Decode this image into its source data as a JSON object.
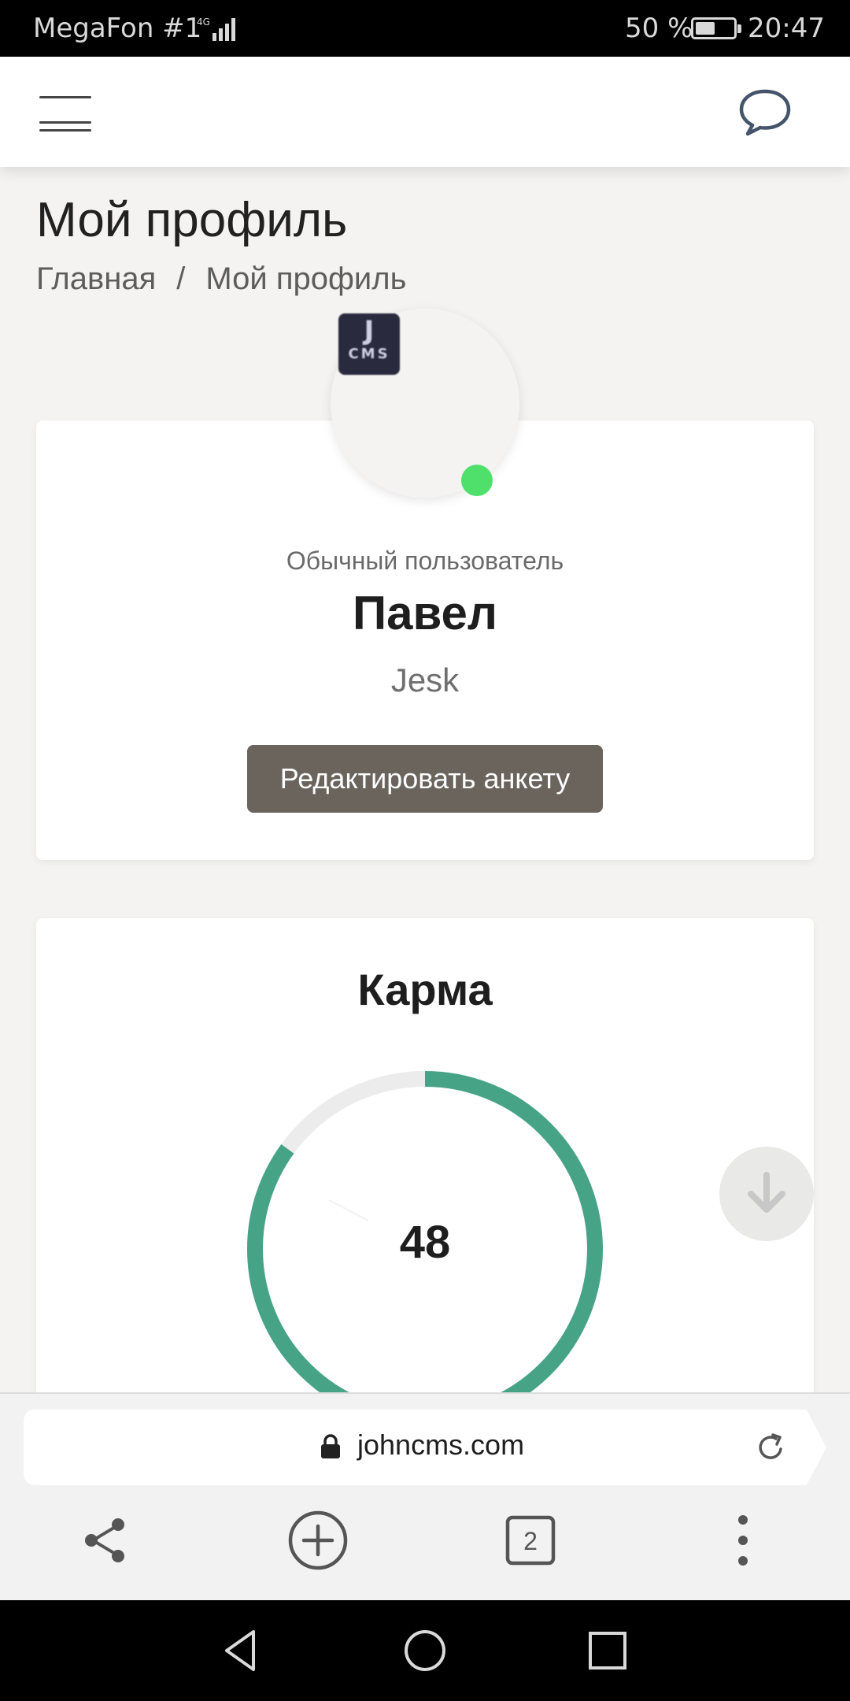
{
  "status_bar": {
    "carrier": "MegaFon #1",
    "network": "4G",
    "battery_percent": "50 %",
    "battery_level": 0.5,
    "time": "20:47"
  },
  "header": {
    "menu_icon": "hamburger-menu-icon",
    "chat_icon": "chat-bubble-icon"
  },
  "page": {
    "title": "Мой профиль",
    "breadcrumb": {
      "home": "Главная",
      "separator": "/",
      "current": "Мой профиль"
    }
  },
  "profile": {
    "avatar_logo": {
      "line1": "J",
      "line2": "CMS"
    },
    "online": true,
    "role": "Обычный пользователь",
    "name": "Павел",
    "login": "Jesk",
    "edit_button": "Редактировать анкету"
  },
  "karma": {
    "title": "Карма",
    "value": "48",
    "fraction": 0.85,
    "colors": {
      "progress": "#47a386",
      "track": "#ececec"
    }
  },
  "browser": {
    "url": "johncms.com",
    "tabs_count": "2",
    "icons": [
      "share-icon",
      "new-tab-plus-icon",
      "tabs-counter-icon",
      "more-vertical-icon"
    ]
  },
  "system_nav": [
    "back-icon",
    "home-icon",
    "recents-icon"
  ]
}
